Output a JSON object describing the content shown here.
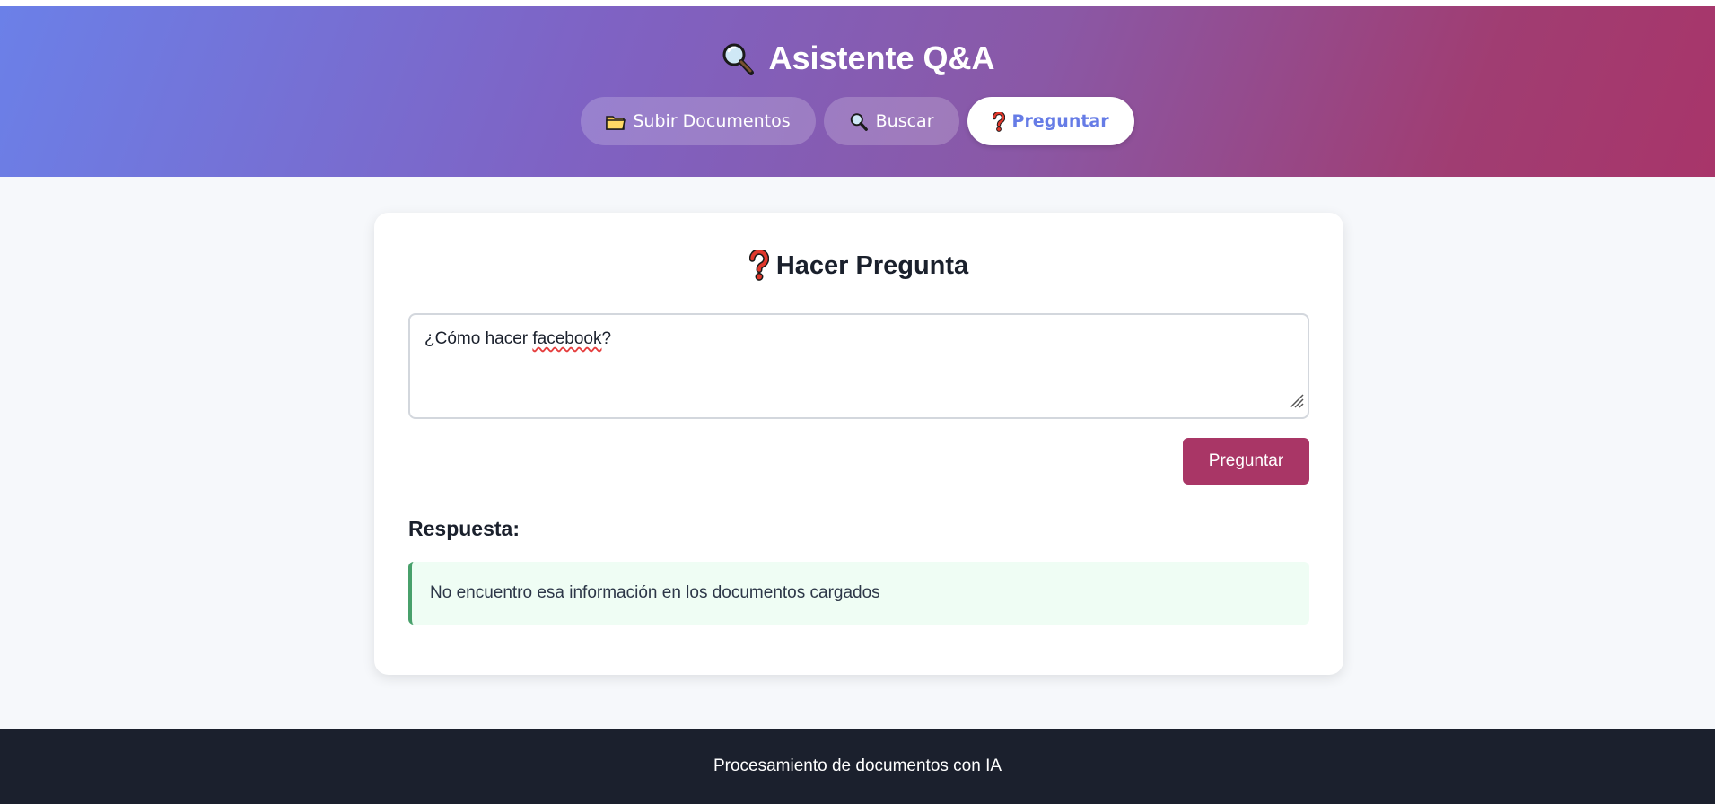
{
  "header": {
    "title": "Asistente Q&A",
    "title_icon": "magnifier-icon",
    "nav": [
      {
        "label": "Subir Documentos",
        "icon": "folder-icon",
        "active": false
      },
      {
        "label": "Buscar",
        "icon": "magnifier-icon",
        "active": false
      },
      {
        "label": "Preguntar",
        "icon": "question-icon",
        "active": true
      }
    ]
  },
  "card": {
    "title": "Hacer Pregunta",
    "title_icon": "question-icon",
    "question": {
      "before": "¿Cómo hacer ",
      "misspelled": "facebook",
      "after": "?"
    },
    "submit_label": "Preguntar",
    "answer_label": "Respuesta:",
    "answer_text": "No encuentro esa información en los documentos cargados"
  },
  "footer": {
    "text": "Procesamiento de documentos con IA"
  },
  "colors": {
    "gradient_start": "#6b80e8",
    "gradient_end": "#a8356a",
    "submit_button": "#a93666",
    "answer_accent": "#48a06b",
    "footer_bg": "#1b202d"
  }
}
